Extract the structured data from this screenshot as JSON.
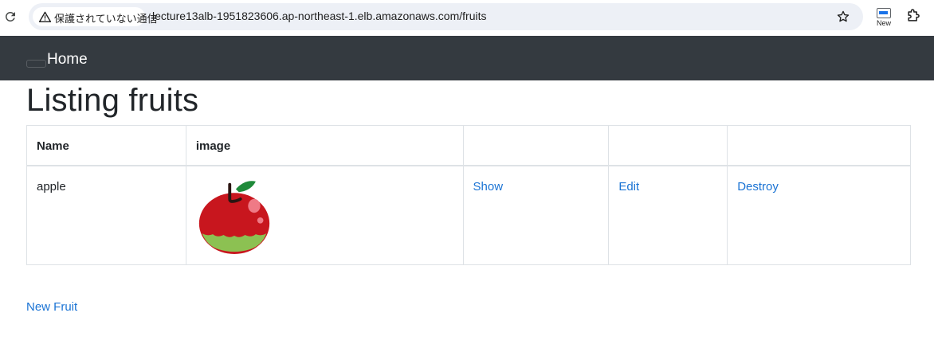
{
  "browser": {
    "security_label": "保護されていない通信",
    "url": "lecture13alb-1951823606.ap-northeast-1.elb.amazonaws.com/fruits",
    "extension_label": "New"
  },
  "navbar": {
    "brand": "Home",
    "background": "#343a40"
  },
  "page": {
    "title": "Listing fruits",
    "link_color": "#1a73d4"
  },
  "table": {
    "headers": [
      "Name",
      "image",
      "",
      "",
      ""
    ],
    "rows": [
      {
        "name": "apple",
        "image_icon": "apple-icon",
        "show": "Show",
        "edit": "Edit",
        "destroy": "Destroy"
      }
    ]
  },
  "footer": {
    "new_link": "New Fruit"
  }
}
